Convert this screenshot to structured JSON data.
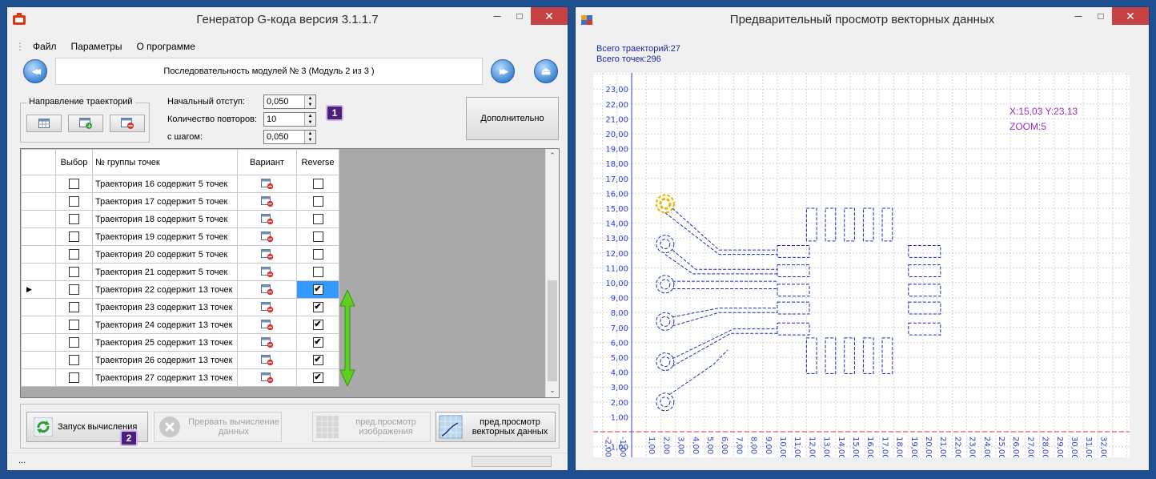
{
  "left_window": {
    "title": "Генератор G-кода версия 3.1.1.7",
    "controls": {
      "minimize": "─",
      "maximize": "□",
      "close": "✕"
    },
    "menu": [
      "Файл",
      "Параметры",
      "О программе"
    ],
    "sequence_label": "Последовательность модулей № 3 (Модуль 2 из 3 )",
    "nav": {
      "prev": "◀◀",
      "next": "▶▶",
      "eject": "⏏"
    },
    "direction_group": "Направление траекторий",
    "fields": {
      "start_offset_label": "Начальный отступ:",
      "start_offset_value": "0,050",
      "repeat_count_label": "Количество повторов:",
      "repeat_count_value": "10",
      "step_label": "с шагом:",
      "step_value": "0,050"
    },
    "advanced_button": "Дополнительно",
    "badge1": "1",
    "badge2": "2",
    "table": {
      "headers": [
        "Выбор",
        "№ группы точек",
        "Вариант",
        "Reverse"
      ],
      "rows": [
        {
          "name": "Траектория 16 содержит 5 точек",
          "reverse": false
        },
        {
          "name": "Траектория 17 содержит 5 точек",
          "reverse": false
        },
        {
          "name": "Траектория 18 содержит 5 точек",
          "reverse": false
        },
        {
          "name": "Траектория 19 содержит 5 точек",
          "reverse": false
        },
        {
          "name": "Траектория 20 содержит 5 точек",
          "reverse": false
        },
        {
          "name": "Траектория 21 содержит 5 точек",
          "reverse": false
        },
        {
          "name": "Траектория 22 содержит 13 точек",
          "reverse": true,
          "current": true
        },
        {
          "name": "Траектория 23 содержит 13 точек",
          "reverse": true
        },
        {
          "name": "Траектория 24 содержит 13 точек",
          "reverse": true
        },
        {
          "name": "Траектория 25 содержит 13 точек",
          "reverse": true
        },
        {
          "name": "Траектория 26 содержит 13 точек",
          "reverse": true
        },
        {
          "name": "Траектория 27 содержит 13 точек",
          "reverse": true
        }
      ]
    },
    "buttons": {
      "run": "Запуск вычисления",
      "abort": "Прервать вычисление данных",
      "preview_image": "пред.просмотр изображения",
      "preview_vector": "пред.просмотр векторных данных"
    },
    "status_text": "..."
  },
  "right_window": {
    "title": "Предварительный просмотр векторных данных",
    "total_paths": "Всего траекторий:27",
    "total_points": "Всего точек:296",
    "coords": "X:15,03 Y:23,13",
    "zoom": "ZOOM:5",
    "y_ticks": [
      "-2,00",
      "-1,00",
      "1,00",
      "2,00",
      "3,00",
      "4,00",
      "5,00",
      "6,00",
      "7,00",
      "8,00",
      "9,00",
      "10,00",
      "11,00",
      "12,00",
      "13,00",
      "14,00",
      "15,00",
      "16,00",
      "17,00",
      "18,00",
      "19,00",
      "20,00",
      "21,00",
      "22,00",
      "23,00"
    ],
    "x_ticks": [
      "-2,00",
      "-1,00",
      "1,00",
      "2,00",
      "3,00",
      "4,00",
      "5,00",
      "6,00",
      "7,00",
      "8,00",
      "9,00",
      "10,00",
      "11,00",
      "12,00",
      "13,00",
      "14,00",
      "15,00",
      "16,00",
      "17,00",
      "18,00",
      "19,00",
      "20,00",
      "21,00",
      "22,00",
      "23,00",
      "24,00",
      "25,00",
      "26,00",
      "27,00",
      "28,00",
      "29,00",
      "30,00",
      "31,00",
      "32,00"
    ],
    "colors": {
      "path": "#1b2fb8",
      "axis": "#2a3fd0",
      "highlight": "#f0b400",
      "info": "#9b2fc7",
      "arrow": "#5fd020"
    }
  }
}
